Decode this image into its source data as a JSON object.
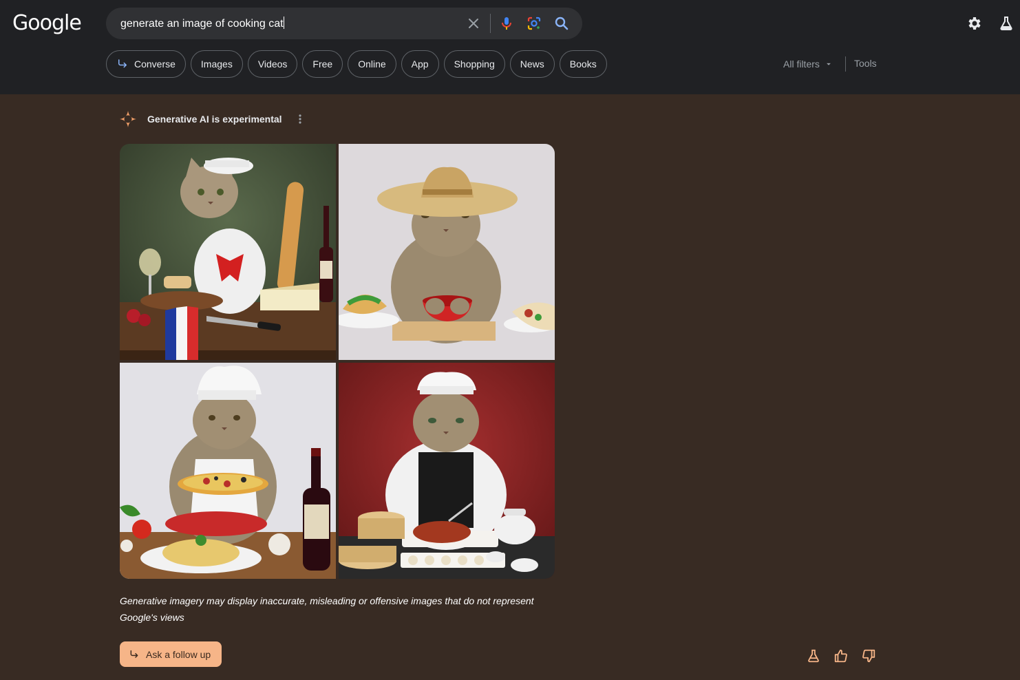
{
  "header": {
    "logo": "Google",
    "search": {
      "query": "generate an image of cooking cat"
    },
    "icons": [
      "close-icon",
      "mic-icon",
      "lens-icon",
      "search-icon",
      "gear-icon",
      "labs-flask-icon"
    ],
    "chips": [
      {
        "label": "Converse",
        "icon": "follow-up-arrow-icon"
      },
      {
        "label": "Images"
      },
      {
        "label": "Videos"
      },
      {
        "label": "Free"
      },
      {
        "label": "Online"
      },
      {
        "label": "App"
      },
      {
        "label": "Shopping"
      },
      {
        "label": "News"
      },
      {
        "label": "Books"
      }
    ],
    "all_filters": "All filters",
    "tools": "Tools"
  },
  "ai": {
    "title": "Generative AI is experimental",
    "images": [
      "cat-chef-french-image",
      "cat-sombrero-mexican-image",
      "cat-chef-italian-image",
      "cat-chef-chinese-image"
    ],
    "disclaimer": "Generative imagery may display inaccurate, misleading or offensive images that do not represent Google's views",
    "followup_label": "Ask a follow up",
    "feedback_icons": [
      "labs-flask-icon",
      "thumbs-up-icon",
      "thumbs-down-icon"
    ]
  },
  "colors": {
    "header_bg": "#202124",
    "page_bg": "#382b23",
    "accent": "#f6b588",
    "ai_spark": "#f6a26a"
  }
}
